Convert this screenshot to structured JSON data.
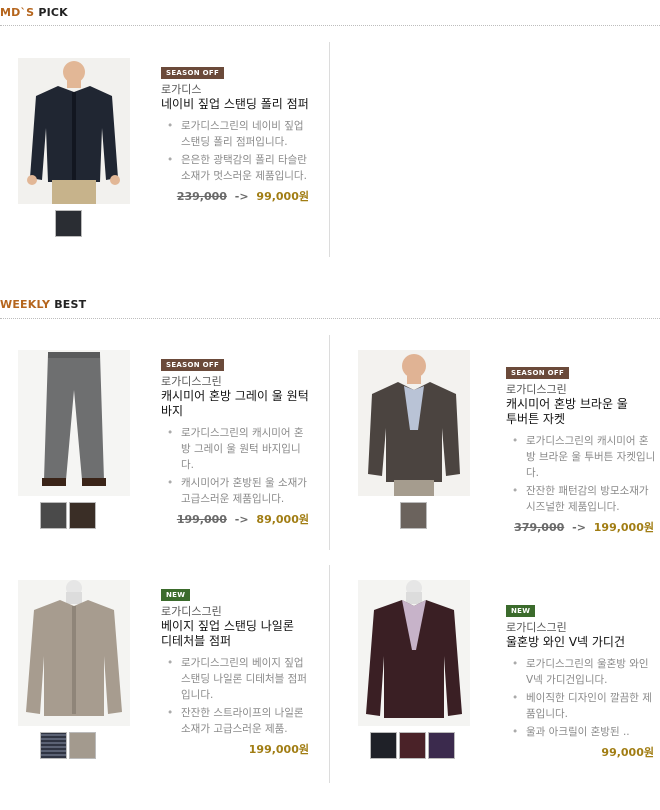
{
  "mds_pick": {
    "title_a": "MD`S",
    "title_b": "PICK",
    "products": [
      {
        "badge": "SEASON OFF",
        "brand": "로가디스",
        "name": "네이비 짚업 스탠딩 폴리 점퍼",
        "desc": [
          "로가디스그린의 네이비 짚업 스탠딩 폴리 점퍼입니다.",
          "은은한 광택감의 폴리 타슬란 소재가 멋스러운 제품입니다."
        ],
        "old_price": "239,000",
        "arrow": "->",
        "price": "99,000원",
        "swatches": [
          "#2a2d33"
        ]
      }
    ]
  },
  "weekly_best": {
    "title_a": "WEEKLY",
    "title_b": "BEST",
    "products": [
      {
        "badge": "SEASON OFF",
        "brand": "로가디스그린",
        "name": "캐시미어 혼방 그레이 울 원턱 바지",
        "desc": [
          "로가디스그린의 캐시미어 혼방 그레이 울 원턱 바지입니다.",
          "캐시미어가 혼방된 울 소재가 고급스러운 제품입니다."
        ],
        "old_price": "199,000",
        "arrow": "->",
        "price": "89,000원",
        "swatches": [
          "#4a4a4a",
          "#3a2e26"
        ]
      },
      {
        "badge": "SEASON OFF",
        "brand": "로가디스그린",
        "name": "캐시미어 혼방 브라운 울 투버튼 자켓",
        "desc": [
          "로가디스그린의 캐시미어 혼방 브라운 울 투버튼 자켓입니다.",
          "잔잔한 패턴감의 방모소재가 시즈널한 제품입니다."
        ],
        "old_price": "379,000",
        "arrow": "->",
        "price": "199,000원",
        "swatches": [
          "#6b635d"
        ]
      },
      {
        "badge": "NEW",
        "brand": "로가디스그린",
        "name": "베이지 짚업 스탠딩 나일론 디테처블 점퍼",
        "desc": [
          "로가디스그린의 베이지 짚업 스탠딩 나일론 디테처블 점퍼입니다.",
          "잔잔한 스트라이프의 나일론 소재가 고급스러운 제품."
        ],
        "old_price": "",
        "arrow": "",
        "price": "199,000원",
        "swatches": [
          "#3a4050",
          "#a39a8e"
        ]
      },
      {
        "badge": "NEW",
        "brand": "로가디스그린",
        "name": "울혼방 와인 V넥 가디건",
        "desc": [
          "로가디스그린의 울혼방 와인 V넥 가디건입니다.",
          "베이직한 디자인이 깔끔한 제품입니다.",
          "울과 아크릴이 혼방된 .."
        ],
        "old_price": "",
        "arrow": "",
        "price": "99,000원",
        "swatches": [
          "#1f2128",
          "#4a2228",
          "#3b2a4d"
        ]
      }
    ]
  }
}
